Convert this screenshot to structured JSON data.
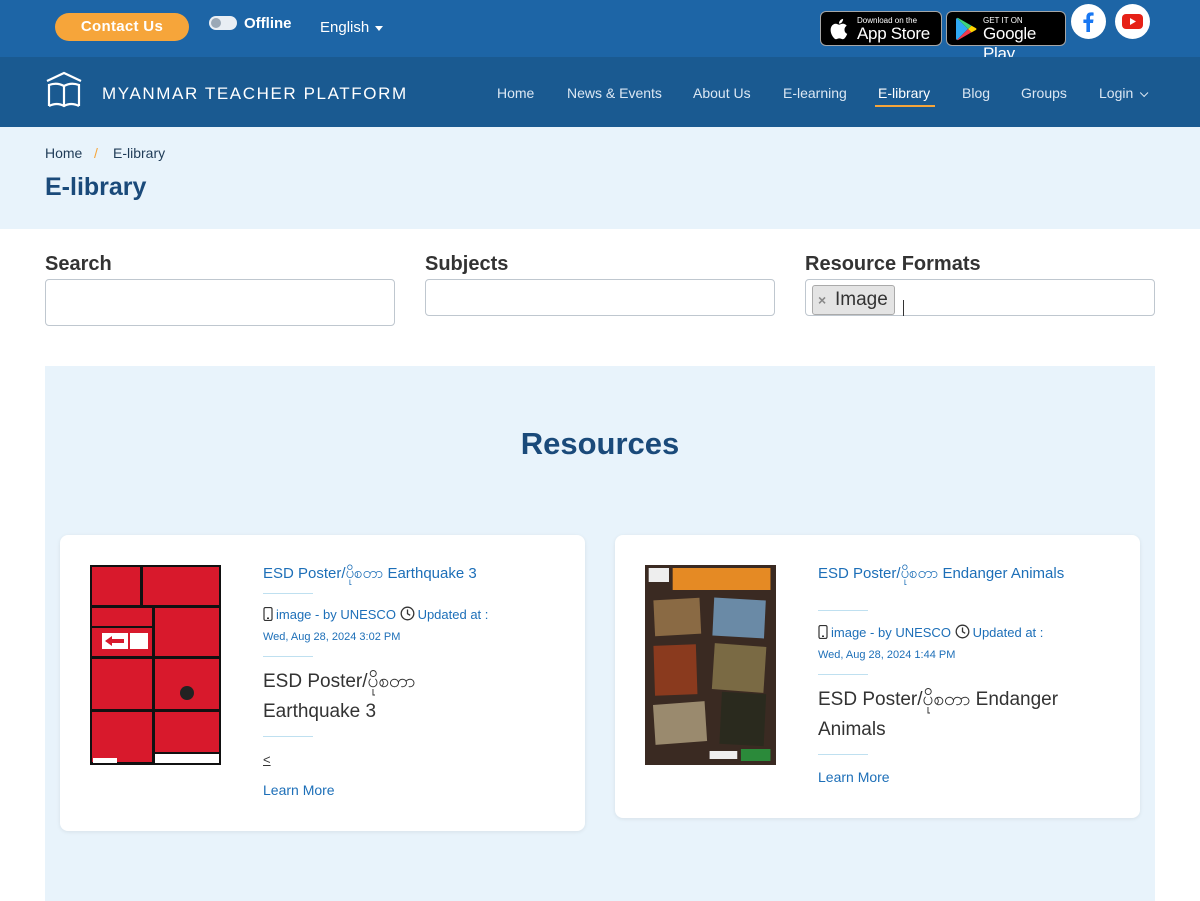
{
  "topbar": {
    "contact_label": "Contact Us",
    "offline_label": "Offline",
    "language": "English",
    "app_store": {
      "small": "Download on the",
      "big": "App Store"
    },
    "google_play": {
      "small": "GET IT ON",
      "big": "Google Play"
    },
    "social": [
      "facebook-icon",
      "youtube-icon"
    ]
  },
  "nav": {
    "brand": "MYANMAR TEACHER PLATFORM",
    "items": [
      "Home",
      "News & Events",
      "About Us",
      "E-learning",
      "E-library",
      "Blog",
      "Groups",
      "Login"
    ],
    "active": "E-library"
  },
  "breadcrumb": {
    "home": "Home",
    "separator": "/",
    "current": "E-library"
  },
  "page_title": "E-library",
  "filters": {
    "search_label": "Search",
    "subjects_label": "Subjects",
    "formats_label": "Resource Formats",
    "formats_selected": "Image",
    "remove_symbol": "×"
  },
  "resources": {
    "title": "Resources",
    "cards": [
      {
        "title": "ESD Poster/ပိုစတာ Earthquake 3",
        "format": "image",
        "by": " - by UNESCO",
        "updated_label": "Updated at :",
        "date": "Wed, Aug 28, 2024 3:02 PM",
        "description": "ESD Poster/ပိုစတာ Earthquake 3",
        "extra": "<",
        "learn_more": "Learn More"
      },
      {
        "title": "ESD Poster/ပိုစတာ Endanger Animals",
        "format": "image",
        "by": " - by UNESCO",
        "updated_label": "Updated at :",
        "date": "Wed, Aug 28, 2024 1:44 PM",
        "description": "ESD Poster/ပိုစတာ Endanger Animals",
        "learn_more": "Learn More"
      }
    ]
  },
  "colors": {
    "topbar": "#1d65a6",
    "navbar": "#1a5a91",
    "accent": "#f6a53a",
    "link": "#1d6fb8",
    "section_bg": "#e8f3fb"
  }
}
